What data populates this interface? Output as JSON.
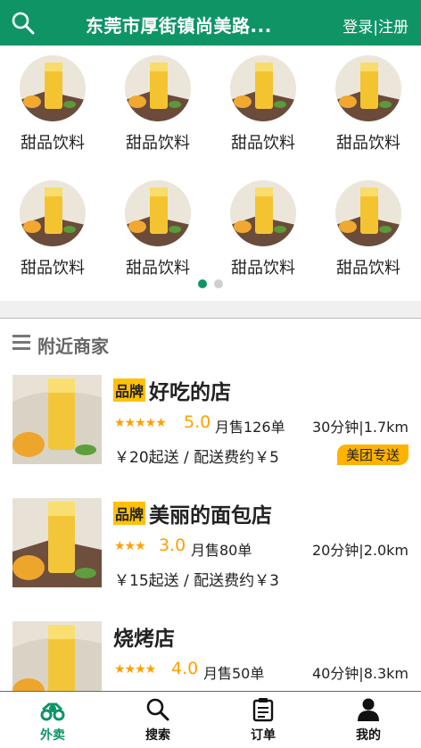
{
  "header": {
    "title": "东莞市厚街镇尚美路...",
    "login_register": "登录|注册",
    "search_icon": "search-icon"
  },
  "categories": [
    {
      "label": "甜品饮料"
    },
    {
      "label": "甜品饮料"
    },
    {
      "label": "甜品饮料"
    },
    {
      "label": "甜品饮料"
    },
    {
      "label": "甜品饮料"
    },
    {
      "label": "甜品饮料"
    },
    {
      "label": "甜品饮料"
    },
    {
      "label": "甜品饮料"
    }
  ],
  "carousel": {
    "page_count": 2,
    "active_index": 0
  },
  "nearby": {
    "title": "附近商家",
    "shops": [
      {
        "brand_tag": "品牌",
        "name": "好吃的店",
        "stars": "★★★★★",
        "rating": "5.0",
        "monthly_sales": "月售126单",
        "time_distance": "30分钟|1.7km",
        "fee": "￥20起送 / 配送费约￥5",
        "delivery_tag": "美团专送"
      },
      {
        "brand_tag": "品牌",
        "name": "美丽的面包店",
        "stars": "★★★",
        "rating": "3.0",
        "monthly_sales": "月售80单",
        "time_distance": "20分钟|2.0km",
        "fee": "￥15起送 / 配送费约￥3",
        "delivery_tag": ""
      },
      {
        "brand_tag": "",
        "name": "烧烤店",
        "stars": "★★★★",
        "rating": "4.0",
        "monthly_sales": "月售50单",
        "time_distance": "40分钟|8.3km",
        "fee": "",
        "delivery_tag": ""
      }
    ]
  },
  "bottom_nav": [
    {
      "label": "外卖",
      "icon": "delivery-icon",
      "active": true
    },
    {
      "label": "搜索",
      "icon": "search-icon",
      "active": false
    },
    {
      "label": "订单",
      "icon": "order-icon",
      "active": false
    },
    {
      "label": "我的",
      "icon": "profile-icon",
      "active": false
    }
  ],
  "colors": {
    "primary": "#0f9466",
    "accent": "#ffa000",
    "tag": "#ffc107"
  }
}
